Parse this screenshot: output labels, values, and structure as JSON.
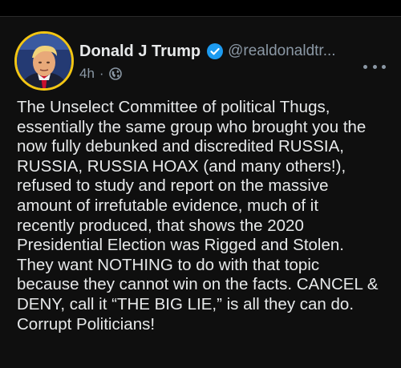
{
  "post": {
    "author_name": "Donald J Trump",
    "author_handle": "@realdonaldtr...",
    "timestamp": "4h",
    "separator": "·",
    "visibility_icon": "globe-icon",
    "verified_icon": "verified-badge-icon",
    "more_icon": "more-options-icon",
    "body_lines": [
      "The Unselect Committee of political Thugs,",
      "essentially the same group who brought you the",
      "now fully debunked and discredited RUSSIA,",
      "RUSSIA, RUSSIA HOAX (and many others!),",
      "refused to study and report on the massive",
      "amount of irrefutable evidence, much of it",
      "recently produced, that shows the 2020",
      "Presidential Election was Rigged and Stolen.",
      "They want NOTHING to do with that topic",
      "because they cannot win on the facts. CANCEL &",
      "DENY, call it “THE BIG LIE,” is all they can do.",
      "Corrupt Politicians!"
    ]
  },
  "colors": {
    "background": "#0f0f0f",
    "text": "#e7e9ea",
    "secondary_text": "#8b98a5",
    "verified_blue": "#1d9bf0",
    "avatar_ring": "#f3c614"
  }
}
